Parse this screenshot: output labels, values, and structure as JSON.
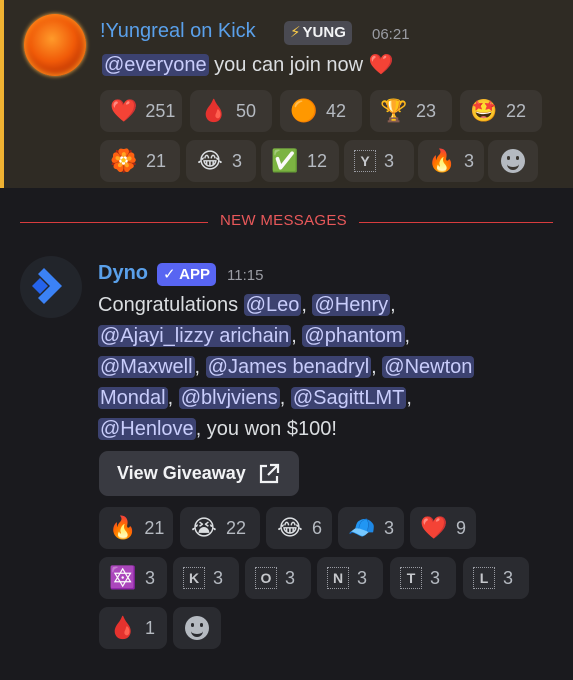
{
  "message1": {
    "author": "!Yungreal on Kick",
    "tag": "YUNG",
    "tag_icon": "lightning-bolt-icon",
    "time": "06:21",
    "mention": "@everyone",
    "text": "you can join now",
    "heart": "❤️",
    "reactions": [
      {
        "emoji": "❤️",
        "name": "heart-icon",
        "count": "251"
      },
      {
        "emoji": "🩸",
        "name": "pink-item-icon",
        "count": "50"
      },
      {
        "emoji": "🟠",
        "name": "orange-circle-icon",
        "count": "42"
      },
      {
        "emoji": "🏆",
        "name": "trophy-icon",
        "count": "23"
      },
      {
        "emoji": "🤩",
        "name": "starstruck-face-icon",
        "count": "22"
      },
      {
        "emoji": "🏵️",
        "name": "orange-badge-icon",
        "count": "21"
      },
      {
        "emoji": "😂",
        "name": "laughing-face-icon",
        "count": "3"
      },
      {
        "emoji": "✅",
        "name": "check-mark-icon",
        "count": "12"
      },
      {
        "letter": "Y",
        "name": "letter-y-icon",
        "count": "3"
      },
      {
        "emoji": "🔥",
        "name": "fire-icon",
        "count": "3"
      }
    ]
  },
  "divider": {
    "label": "NEW MESSAGES"
  },
  "message2": {
    "author": "Dyno",
    "tag": "✓ APP",
    "time": "11:15",
    "body": {
      "congrats": "Congratulations",
      "m1": "@Leo",
      "s1": ", ",
      "m2": "@Henry",
      "s2": ",",
      "m3": "@Ajayi_lizzy arichain",
      "s3": ", ",
      "m4": "@phantom",
      "s4": ",",
      "m5": "@Maxwell",
      "s5": ", ",
      "m6": "@James benadryl",
      "s6": ", ",
      "m7a": "@Newton",
      "m7b": "Mondal",
      "s7": ", ",
      "m8": "@blvjviens",
      "s8": ", ",
      "m9": "@SagittLMT",
      "s9": ",",
      "m10": "@Henlove",
      "end": ", you won $100!"
    },
    "button": {
      "label": "View Giveaway",
      "icon": "external-link-icon"
    },
    "reactions": [
      {
        "emoji": "🔥",
        "name": "fire-icon",
        "count": "21"
      },
      {
        "emoji": "😭",
        "name": "crying-face-icon",
        "count": "22"
      },
      {
        "emoji": "😂",
        "name": "laughing-face-icon",
        "count": "6"
      },
      {
        "emoji": "🧢",
        "name": "blue-cap-icon",
        "count": "3"
      },
      {
        "emoji": "❤️",
        "name": "heart-icon",
        "count": "9"
      },
      {
        "emoji": "🔯",
        "name": "star-of-david-icon",
        "count": "3"
      },
      {
        "letter": "K",
        "name": "letter-k-icon",
        "count": "3"
      },
      {
        "letter": "O",
        "name": "letter-o-icon",
        "count": "3"
      },
      {
        "letter": "N",
        "name": "letter-n-icon",
        "count": "3"
      },
      {
        "letter": "T",
        "name": "letter-t-icon",
        "count": "3"
      },
      {
        "letter": "L",
        "name": "letter-l-icon",
        "count": "3"
      },
      {
        "emoji": "🩸",
        "name": "pink-item-icon",
        "count": "1"
      }
    ]
  },
  "colors": {
    "highlight_bg": "#2f2b24",
    "highlight_bar": "#f0b232",
    "author": "#5aa0ea",
    "mention_bg": "#3c4270",
    "divider": "#d83c3e",
    "app_tag": "#5865f2"
  }
}
